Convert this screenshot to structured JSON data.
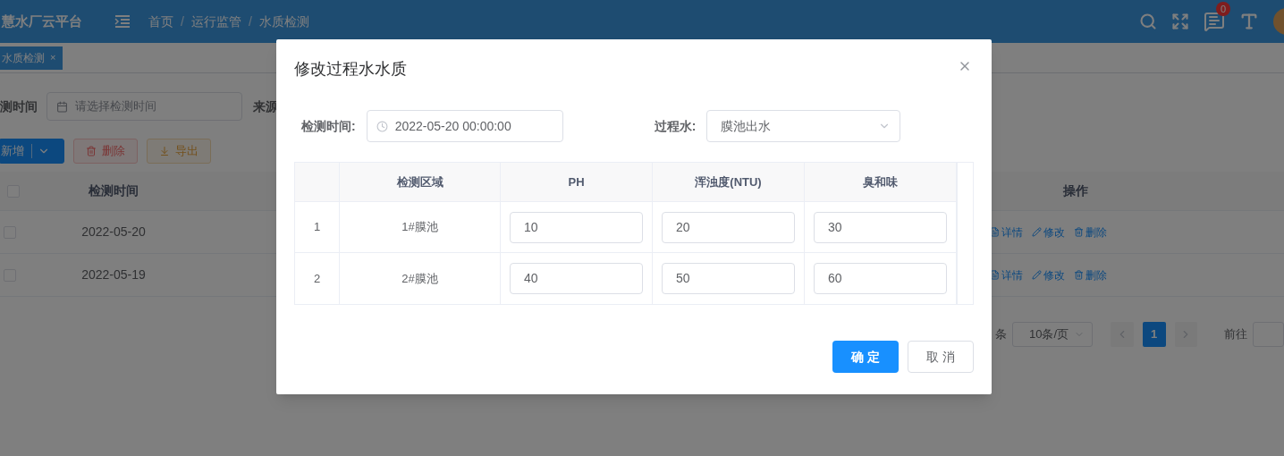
{
  "header": {
    "logo": "慧水厂云平台",
    "breadcrumbs": [
      "首页",
      "运行监管",
      "水质检测"
    ],
    "breadcrumb_separator": "/",
    "message_badge": "0"
  },
  "tabs": [
    {
      "label": "水质检测",
      "close": "×",
      "selected": true
    }
  ],
  "filter": {
    "label": "测时间",
    "date_placeholder": "请选择检测时间",
    "label_2": "来源"
  },
  "toolbar": {
    "buttons": [
      {
        "kind": "primary-split",
        "label": "新增"
      },
      {
        "kind": "danger",
        "label": "删除"
      },
      {
        "kind": "warning",
        "label": "导出"
      }
    ]
  },
  "table": {
    "select_all": {
      "checked": false
    },
    "columns": [
      "检测时间",
      "操作"
    ],
    "rows": [
      {
        "checked": false,
        "date": "2022-05-20",
        "actions": [
          {
            "kind": "view",
            "label": "详情"
          },
          {
            "kind": "edit",
            "label": "修改"
          },
          {
            "kind": "delete",
            "label": "删除"
          }
        ]
      },
      {
        "checked": false,
        "date": "2022-05-19",
        "actions": [
          {
            "kind": "view",
            "label": "详情"
          },
          {
            "kind": "edit",
            "label": "修改"
          },
          {
            "kind": "delete",
            "label": "删除"
          }
        ]
      }
    ]
  },
  "pagination": {
    "total_suffix": "条",
    "page_size": "10条/页",
    "pages": [
      {
        "label": "1",
        "selected": true
      }
    ],
    "goto_label": "前往"
  },
  "dialog": {
    "title": "修改过程水水质",
    "fields": [
      {
        "label": "检测时间:",
        "kind": "datetime",
        "value": "2022-05-20 00:00:00"
      },
      {
        "label": "过程水:",
        "kind": "select",
        "value": "膜池出水"
      }
    ],
    "table": {
      "columns": [
        "检测区域",
        "PH",
        "浑浊度(NTU)",
        "臭和味"
      ],
      "rows": [
        {
          "index": "1",
          "area": "1#膜池",
          "values": [
            "10",
            "20",
            "30"
          ]
        },
        {
          "index": "2",
          "area": "2#膜池",
          "values": [
            "40",
            "50",
            "60"
          ]
        }
      ]
    },
    "buttons": [
      {
        "kind": "primary",
        "label": "确 定"
      },
      {
        "kind": "default",
        "label": "取 消"
      }
    ]
  }
}
